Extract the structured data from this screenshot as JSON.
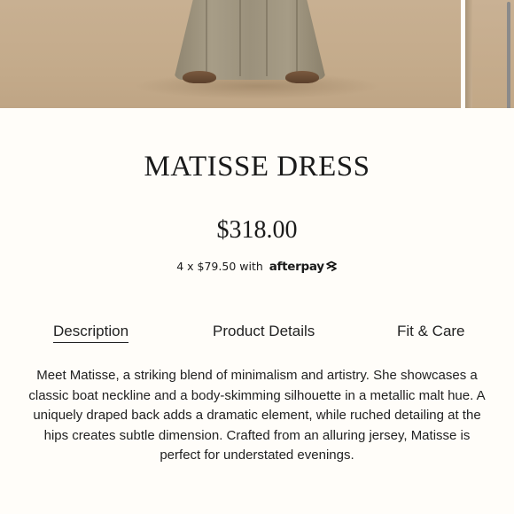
{
  "gallery": {
    "main_image": "dress-product-photo",
    "next_image": "dress-product-photo-next",
    "colors": {
      "backdrop": "#c6ae8f",
      "dress": "#9d937e"
    }
  },
  "product": {
    "title": "MATISSE DRESS",
    "price": "$318.00",
    "installments": {
      "text": "4 x $79.50 with",
      "provider": "afterpay",
      "provider_icon": "afterpay-arrows-icon"
    }
  },
  "tabs": {
    "items": [
      {
        "label": "Description",
        "active": true
      },
      {
        "label": "Product Details",
        "active": false
      },
      {
        "label": "Fit & Care",
        "active": false
      }
    ]
  },
  "description": {
    "text": "Meet Matisse, a striking blend of minimalism and artistry. She showcases a classic boat neckline and a body-skimming silhouette in a metallic malt hue. A uniquely draped back adds a dramatic element, while ruched detailing at the hips creates subtle dimension. Crafted from an alluring jersey, Matisse is perfect for understated evenings."
  }
}
